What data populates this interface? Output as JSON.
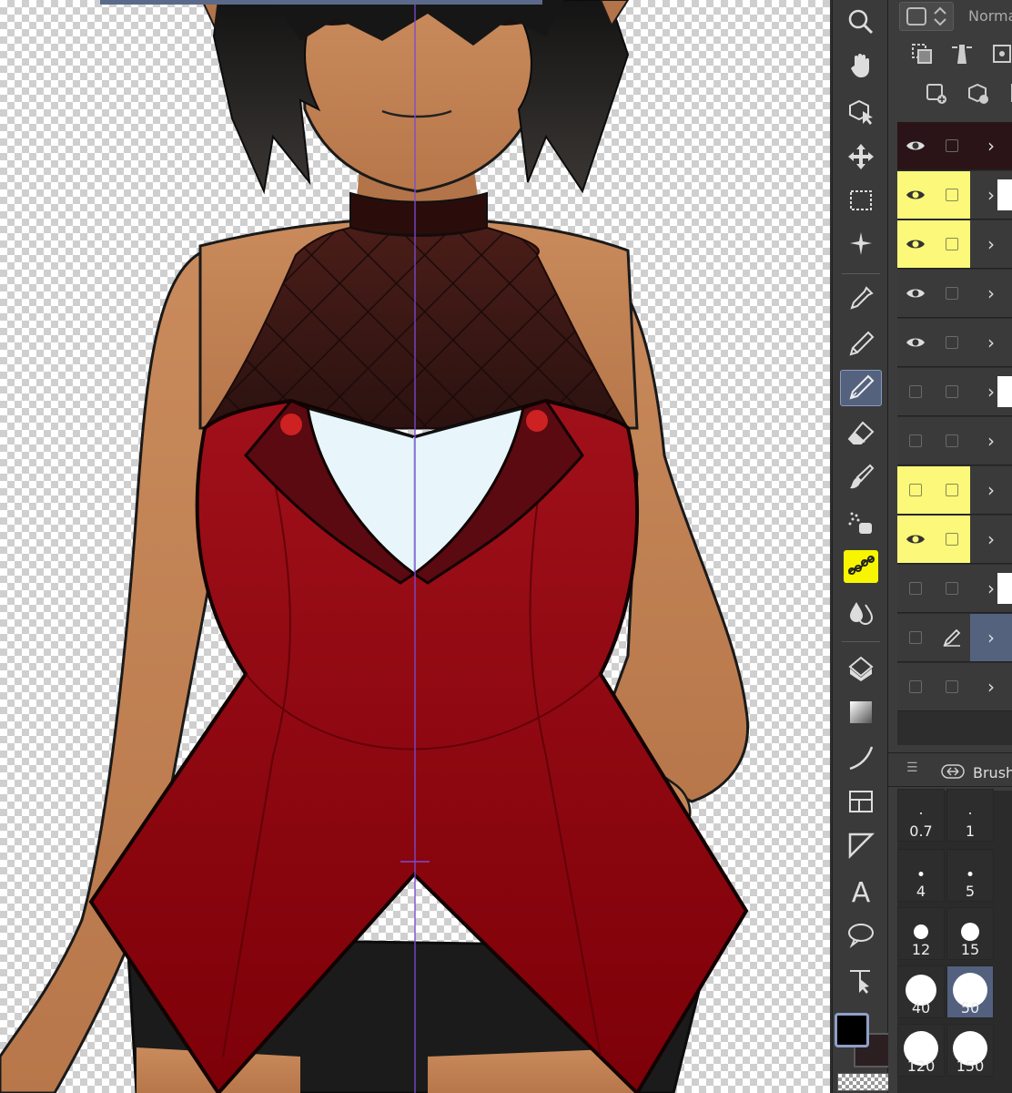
{
  "app": {
    "accent_color": "#54627e",
    "highlight_color": "#f7f500"
  },
  "canvas": {
    "background": "transparency-checkerboard",
    "subject": "illustration-character-red-top"
  },
  "toolbar": {
    "tools": [
      {
        "id": "zoom",
        "icon": "magnifier-icon"
      },
      {
        "id": "hand",
        "icon": "hand-icon"
      },
      {
        "id": "object",
        "icon": "object-select-icon"
      },
      {
        "id": "move",
        "icon": "move-icon"
      },
      {
        "id": "selection",
        "icon": "marquee-icon"
      },
      {
        "id": "auto-select",
        "icon": "magic-wand-icon"
      },
      {
        "id": "eyedropper",
        "icon": "eyedropper-icon"
      },
      {
        "id": "pen",
        "icon": "pen-nib-icon"
      },
      {
        "id": "pencil",
        "icon": "pencil-icon",
        "active": true
      },
      {
        "id": "eraser",
        "icon": "eraser-icon"
      },
      {
        "id": "brush",
        "icon": "brush-icon"
      },
      {
        "id": "airbrush",
        "icon": "airbrush-icon"
      },
      {
        "id": "decoration",
        "icon": "decoration-icon",
        "highlighted": true
      },
      {
        "id": "blend",
        "icon": "blend-icon"
      },
      {
        "id": "fill",
        "icon": "fill-bucket-icon"
      },
      {
        "id": "gradient",
        "icon": "gradient-icon"
      },
      {
        "id": "figure",
        "icon": "curve-icon"
      },
      {
        "id": "frame",
        "icon": "frame-border-icon"
      },
      {
        "id": "ruler",
        "icon": "ruler-icon"
      },
      {
        "id": "text",
        "icon": "text-icon",
        "label": "A"
      },
      {
        "id": "balloon",
        "icon": "speech-balloon-icon"
      },
      {
        "id": "correct-line",
        "icon": "correct-line-icon"
      }
    ],
    "main_color": "#000000",
    "sub_color": "#2c1f22"
  },
  "panel": {
    "blend_mode": "Norma",
    "layers": [
      {
        "visible": true,
        "locked_col_yellow": false,
        "eye_yellow": false,
        "dark": true,
        "thumb": false
      },
      {
        "visible": true,
        "eye_yellow": true,
        "locked_col_yellow": true,
        "thumb": true
      },
      {
        "visible": true,
        "eye_yellow": true,
        "locked_col_yellow": true,
        "thumb": false
      },
      {
        "visible": true,
        "eye_yellow": false,
        "locked_col_yellow": false,
        "thumb": false
      },
      {
        "visible": true,
        "eye_yellow": false,
        "locked_col_yellow": false,
        "thumb": false
      },
      {
        "visible": false,
        "eye_yellow": false,
        "locked_col_yellow": false,
        "thumb": true
      },
      {
        "visible": false,
        "eye_yellow": false,
        "locked_col_yellow": false,
        "thumb": false
      },
      {
        "visible": false,
        "eye_yellow": true,
        "locked_col_yellow": true,
        "thumb": false
      },
      {
        "visible": true,
        "eye_yellow": true,
        "locked_col_yellow": true,
        "thumb": false
      },
      {
        "visible": false,
        "eye_yellow": false,
        "locked_col_yellow": false,
        "thumb": true
      },
      {
        "visible": false,
        "eye_yellow": false,
        "locked_col_yellow": false,
        "editing": true,
        "selected": true,
        "thumb": false
      },
      {
        "visible": false,
        "eye_yellow": false,
        "locked_col_yellow": false,
        "thumb": false
      }
    ],
    "brush_panel_title": "Brush",
    "brush_sizes": [
      "0.7",
      "1",
      "4",
      "5",
      "12",
      "15",
      "40",
      "50",
      "120",
      "150"
    ],
    "selected_brush_size": "50"
  }
}
